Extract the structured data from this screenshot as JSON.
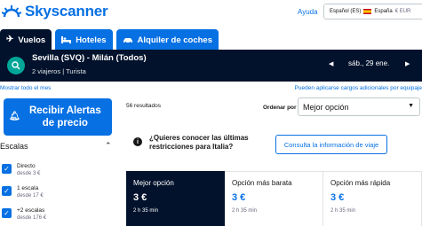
{
  "header": {
    "logo_text": "Skyscanner",
    "help_label": "Ayuda",
    "locale": {
      "language": "Español (ES)",
      "country": "España",
      "currency": "€ EUR"
    }
  },
  "tabs": [
    {
      "label": "Vuelos",
      "icon": "plane-icon",
      "active": true
    },
    {
      "label": "Hoteles",
      "icon": "bed-icon",
      "active": false
    },
    {
      "label": "Alquiler de coches",
      "icon": "car-icon",
      "active": false
    }
  ],
  "search": {
    "icon": "search-icon",
    "route": "Sevilla (SVQ) - Milán (Todos)",
    "travelers": "2 viajeros",
    "cabin": "Turista",
    "date": "sáb., 29 ene."
  },
  "info": {
    "show_month": "Mostrar todo el mes",
    "extra_fees": "Pueden aplicarse cargos adicionales por equipaje"
  },
  "sidebar": {
    "alert_button": "Recibir Alertas de precio",
    "filter_title": "Escalas",
    "stops": [
      {
        "label": "Directo",
        "price": "desde 3 €",
        "checked": true
      },
      {
        "label": "1 escala",
        "price": "desde 17 €",
        "checked": true
      },
      {
        "label": "+2 escalas",
        "price": "desde 176 €",
        "checked": true
      }
    ]
  },
  "results": {
    "count": "56 resultados",
    "sort_label": "Ordenar por",
    "sort_value": "Mejor opción",
    "restrictions_text": "¿Quieres conocer las últimas restricciones para Italia?",
    "consult_button": "Consulta la información de viaje",
    "sort_tabs": [
      {
        "label": "Mejor opción",
        "price": "3 €",
        "duration": "2 h 35 min",
        "active": true
      },
      {
        "label": "Opción más barata",
        "price": "3 €",
        "duration": "2 h 35 min",
        "active": false
      },
      {
        "label": "Opción más rápida",
        "price": "3 €",
        "duration": "2 h 35 min",
        "active": false
      }
    ]
  },
  "colors": {
    "brand_blue": "#0770e3",
    "navy": "#02122c",
    "teal": "#00a698"
  }
}
